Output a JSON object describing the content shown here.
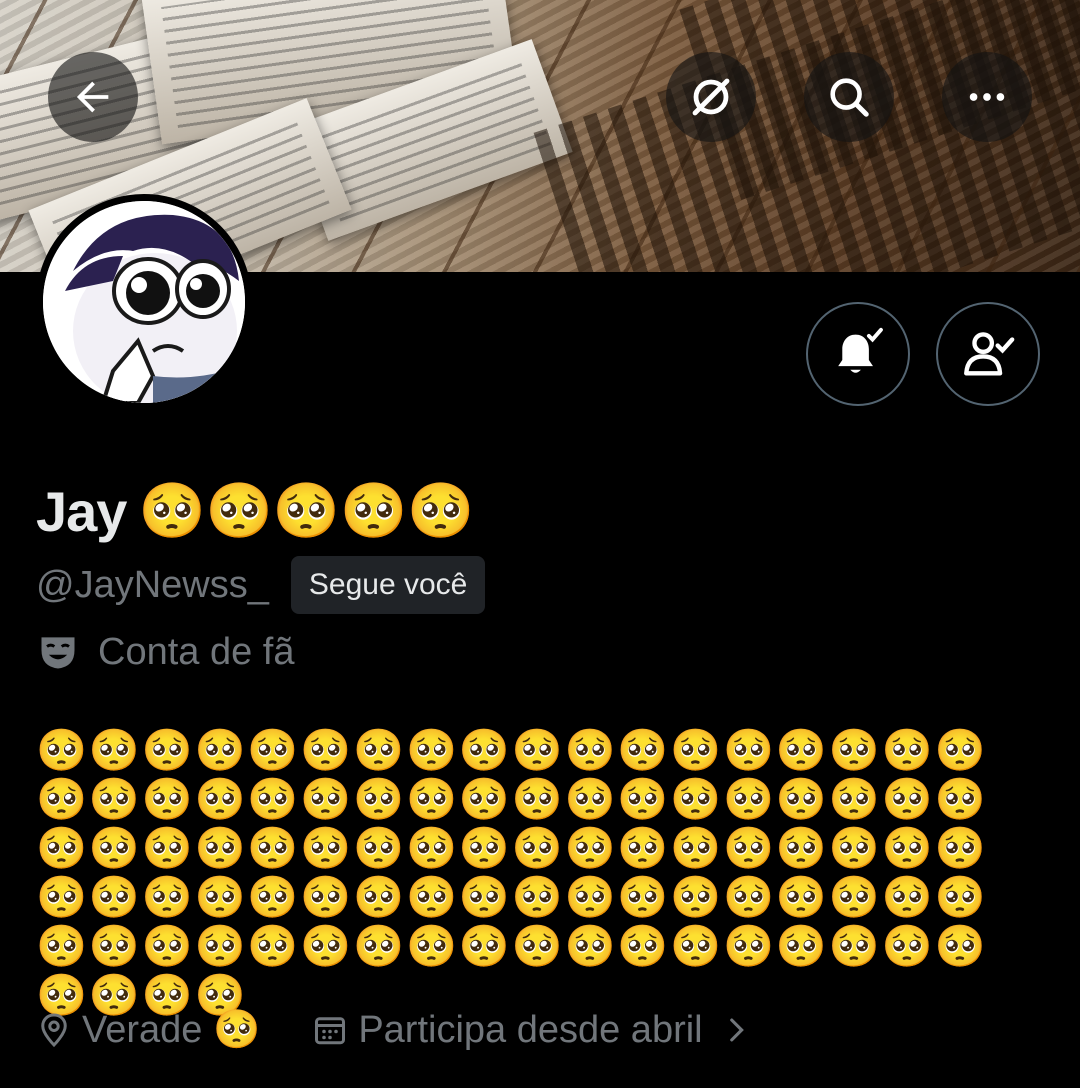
{
  "header": {
    "back_icon": "arrow-left-icon",
    "grok_icon": "grok-icon",
    "search_icon": "search-icon",
    "more_icon": "more-horizontal-icon"
  },
  "profile": {
    "name": "Jay",
    "name_emoji": "🥺🥺🥺🥺🥺",
    "handle": "@JayNewss_",
    "follows_you": "Segue você",
    "account_label": "Conta de fã",
    "account_label_icon": "theater-mask-icon",
    "bio": "🥺🥺🥺🥺🥺🥺🥺🥺🥺🥺🥺🥺🥺🥺🥺🥺🥺🥺🥺🥺🥺🥺🥺🥺🥺🥺🥺🥺🥺🥺🥺🥺🥺🥺🥺🥺🥺🥺🥺🥺🥺🥺🥺🥺🥺🥺🥺🥺🥺🥺🥺🥺🥺🥺🥺🥺🥺🥺🥺🥺🥺🥺🥺🥺🥺🥺🥺🥺🥺🥺🥺🥺🥺🥺🥺🥺🥺🥺🥺🥺🥺🥺🥺🥺🥺🥺🥺🥺🥺🥺🥺🥺🥺🥺",
    "location": "Verade 🥺",
    "joined": "Participa desde abril"
  },
  "actions": {
    "notifications_icon": "bell-check-icon",
    "following_icon": "person-check-icon"
  }
}
